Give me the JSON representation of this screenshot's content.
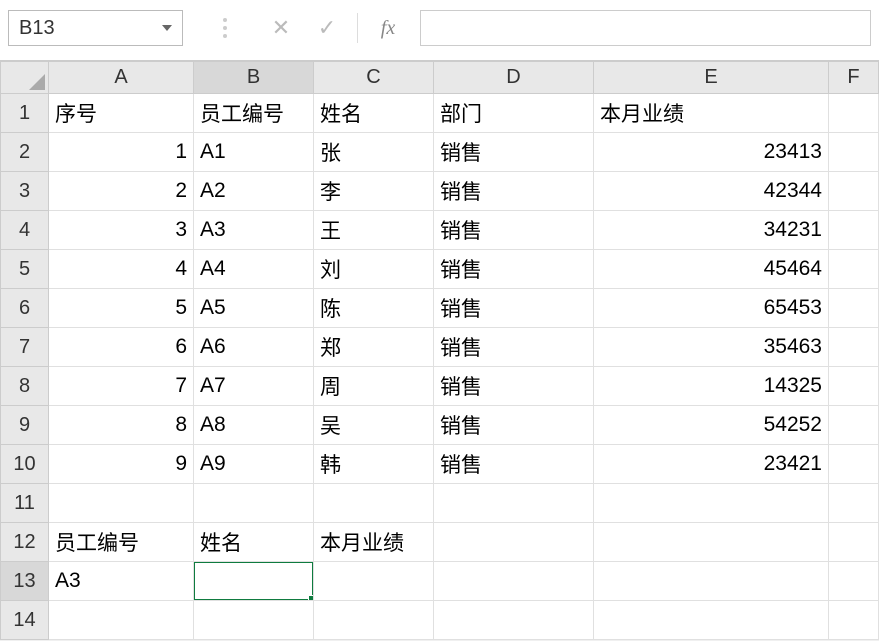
{
  "name_box": "B13",
  "formula_value": "",
  "columns": [
    "A",
    "B",
    "C",
    "D",
    "E",
    "F"
  ],
  "rows_count": 14,
  "active_col": "B",
  "active_row": 13,
  "cells": {
    "r1": {
      "A": "序号",
      "B": "员工编号",
      "C": "姓名",
      "D": "部门",
      "E": "本月业绩"
    },
    "r2": {
      "A": "1",
      "B": "A1",
      "C": "张",
      "D": "销售",
      "E": "23413"
    },
    "r3": {
      "A": "2",
      "B": "A2",
      "C": "李",
      "D": "销售",
      "E": "42344"
    },
    "r4": {
      "A": "3",
      "B": "A3",
      "C": "王",
      "D": "销售",
      "E": "34231"
    },
    "r5": {
      "A": "4",
      "B": "A4",
      "C": "刘",
      "D": "销售",
      "E": "45464"
    },
    "r6": {
      "A": "5",
      "B": "A5",
      "C": "陈",
      "D": "销售",
      "E": "65453"
    },
    "r7": {
      "A": "6",
      "B": "A6",
      "C": "郑",
      "D": "销售",
      "E": "35463"
    },
    "r8": {
      "A": "7",
      "B": "A7",
      "C": "周",
      "D": "销售",
      "E": "14325"
    },
    "r9": {
      "A": "8",
      "B": "A8",
      "C": "吴",
      "D": "销售",
      "E": "54252"
    },
    "r10": {
      "A": "9",
      "B": "A9",
      "C": "韩",
      "D": "销售",
      "E": "23421"
    },
    "r11": {},
    "r12": {
      "A": "员工编号",
      "B": "姓名",
      "C": "本月业绩"
    },
    "r13": {
      "A": "A3"
    },
    "r14": {}
  },
  "numeric_cols_rows": {
    "A": [
      2,
      3,
      4,
      5,
      6,
      7,
      8,
      9,
      10
    ],
    "E": [
      2,
      3,
      4,
      5,
      6,
      7,
      8,
      9,
      10
    ]
  }
}
